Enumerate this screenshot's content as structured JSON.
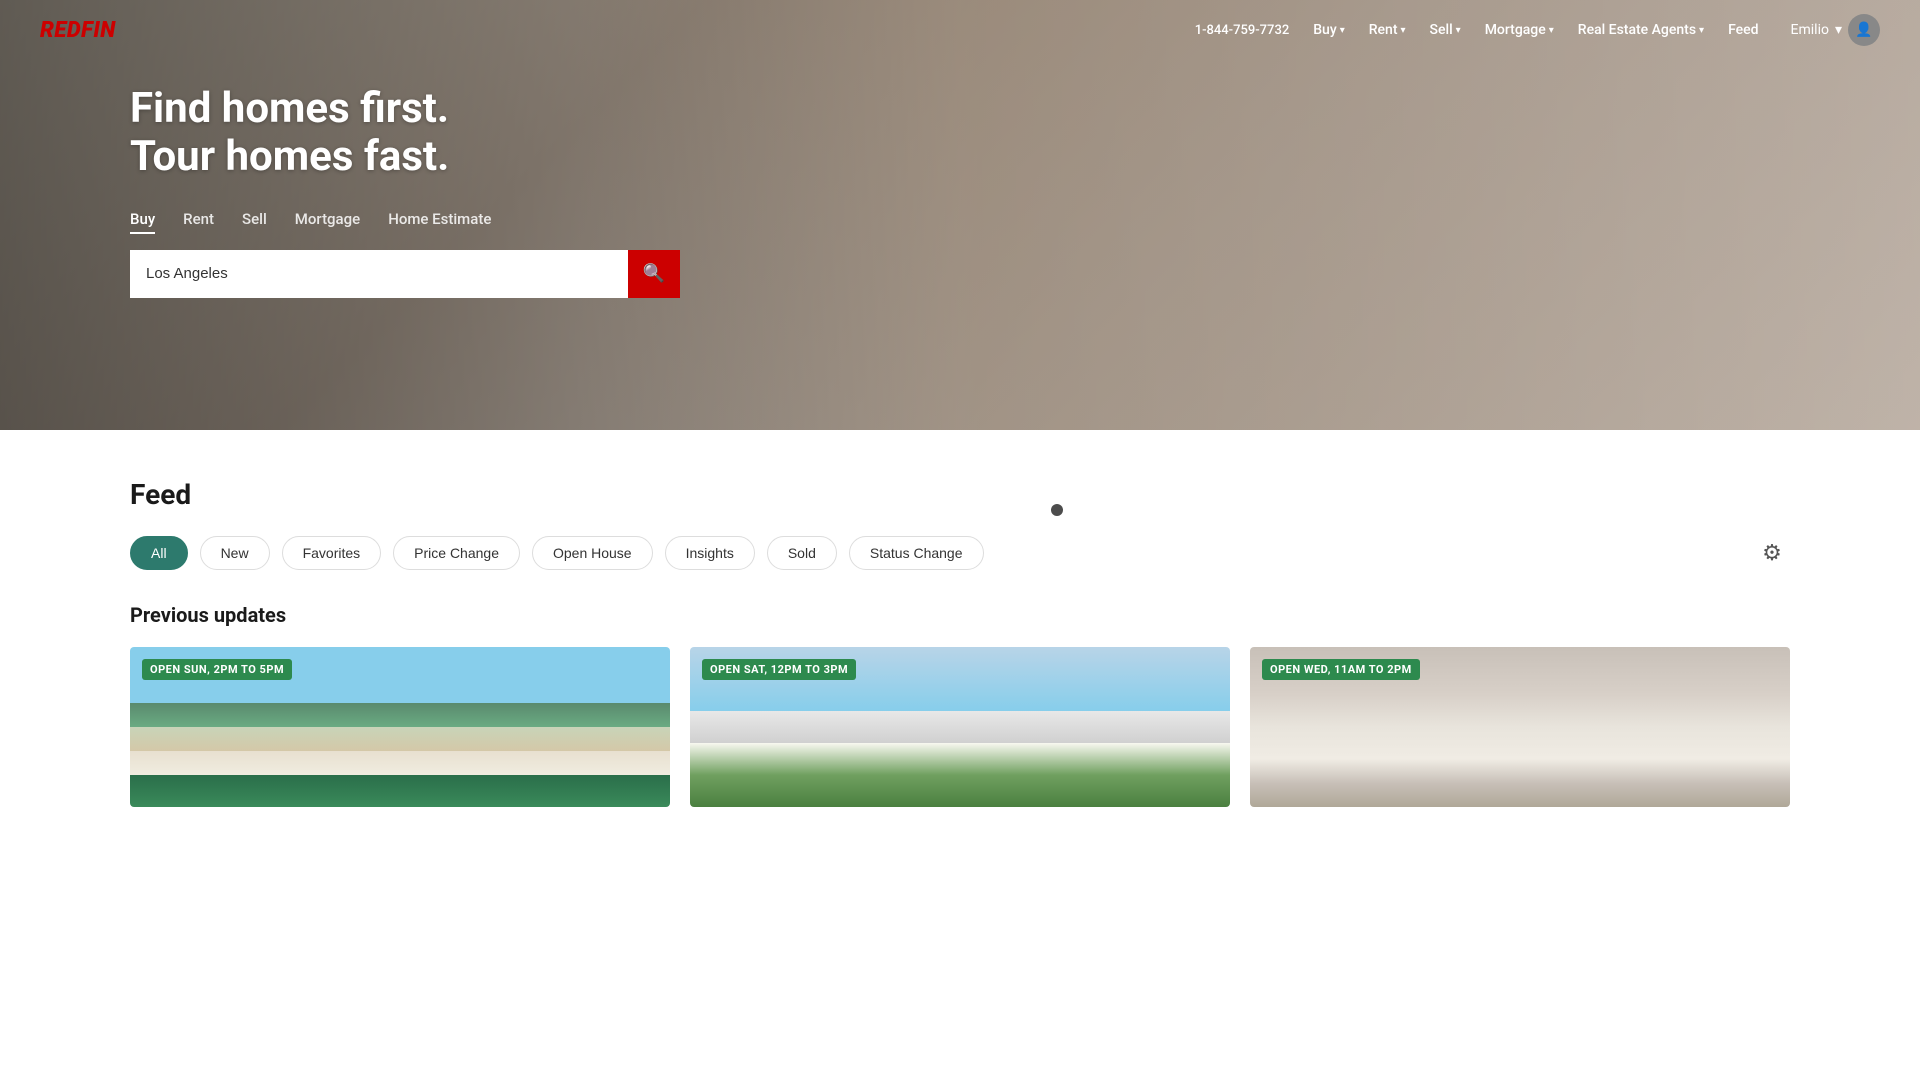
{
  "brand": {
    "logo": "REDFIN",
    "phone": "1-844-759-7732"
  },
  "navbar": {
    "links": [
      {
        "label": "Buy",
        "has_dropdown": true
      },
      {
        "label": "Rent",
        "has_dropdown": true
      },
      {
        "label": "Sell",
        "has_dropdown": true
      },
      {
        "label": "Mortgage",
        "has_dropdown": true
      },
      {
        "label": "Real Estate Agents",
        "has_dropdown": true
      },
      {
        "label": "Feed",
        "has_dropdown": false
      }
    ],
    "user": {
      "name": "Emilio",
      "has_dropdown": true
    }
  },
  "hero": {
    "headline_line1": "Find homes first.",
    "headline_line2": "Tour homes fast.",
    "tabs": [
      {
        "label": "Buy",
        "active": true
      },
      {
        "label": "Rent",
        "active": false
      },
      {
        "label": "Sell",
        "active": false
      },
      {
        "label": "Mortgage",
        "active": false
      },
      {
        "label": "Home Estimate",
        "active": false
      }
    ],
    "search": {
      "placeholder": "Los Angeles",
      "value": "Los Angeles"
    }
  },
  "feed": {
    "title": "Feed",
    "filters": [
      {
        "label": "All",
        "active": true
      },
      {
        "label": "New",
        "active": false
      },
      {
        "label": "Favorites",
        "active": false
      },
      {
        "label": "Price Change",
        "active": false
      },
      {
        "label": "Open House",
        "active": false
      },
      {
        "label": "Insights",
        "active": false
      },
      {
        "label": "Sold",
        "active": false
      },
      {
        "label": "Status Change",
        "active": false
      }
    ],
    "previous_updates_label": "Previous updates",
    "cards": [
      {
        "open_house": "OPEN SUN, 2PM TO 5PM",
        "image_type": "1"
      },
      {
        "open_house": "OPEN SAT, 12PM TO 3PM",
        "image_type": "2"
      },
      {
        "open_house": "OPEN WED, 11AM TO 2PM",
        "image_type": "3"
      }
    ]
  },
  "icons": {
    "search": "🔍",
    "chevron_down": "▾",
    "gear": "⚙",
    "user": "👤"
  }
}
